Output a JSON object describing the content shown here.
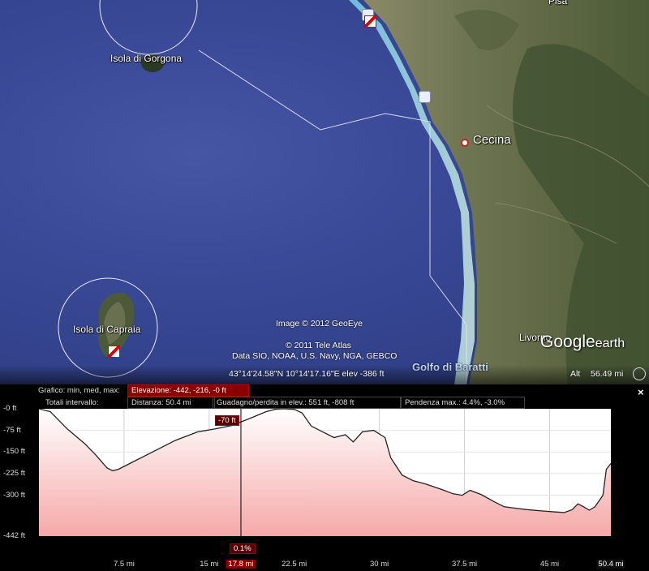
{
  "map": {
    "labels": {
      "gorgona": "Isola di Gorgona",
      "capraia": "Isola di Capraia",
      "cecina": "Cecina",
      "livorno": "Livorno",
      "pisa": "Pisa",
      "golfo": "Golfo di Baratti"
    },
    "credits": {
      "image": "Image © 2012 GeoEye",
      "tele_atlas": "© 2011 Tele Atlas",
      "data": "Data SIO, NOAA, U.S. Navy, NGA, GEBCO"
    },
    "status": {
      "coords": "43°14'24.58\"N  10°14'17.16\"E  elev  -386 ft",
      "alt_label": "Alt",
      "alt_value": "56.49 mi"
    },
    "logo": {
      "google": "Google",
      "earth": "earth"
    }
  },
  "elevation_panel": {
    "row1_label": "Grafico: min, med, max:",
    "elevation_stat": "Elevazione: -442, -216, -0 ft",
    "row2_label": "Totali intervallo:",
    "distance_stat": "Distanza: 50.4 mi",
    "gain_stat": "Guadagno/perdita in elev.: 551 ft, -808 ft",
    "slope_stat": "Pendenza max.: 4.4%, -3.0%",
    "close_label": "×",
    "cursor_value": "-70 ft",
    "cursor_percent": "0.1%",
    "colors": {
      "accent": "#8a0000",
      "fill_top": "#ffffff",
      "fill_bottom": "#f6a8a8",
      "line": "#222222"
    }
  },
  "chart_data": {
    "type": "area",
    "title": "",
    "xlabel": "",
    "ylabel": "",
    "x_ticks": [
      "7.5 mi",
      "15 mi",
      "17.8 mi",
      "22.5 mi",
      "30 mi",
      "37.5 mi",
      "45 mi",
      "50.4 mi"
    ],
    "y_ticks": [
      "-0 ft",
      "-75 ft",
      "-150 ft",
      "-225 ft",
      "-300 ft",
      "-442 ft"
    ],
    "xlim": [
      0,
      50.4
    ],
    "ylim": [
      -442,
      0
    ],
    "grid": true,
    "cursor_x": 17.8,
    "series": [
      {
        "x": [
          0,
          1,
          2.5,
          4,
          5,
          6,
          6.5,
          7,
          8,
          10,
          12,
          14,
          15.5,
          17,
          18.5,
          20,
          20.8,
          21.5,
          22.5,
          23.2,
          24,
          25,
          26,
          27,
          27.7,
          28.5,
          29.5,
          30.5,
          31,
          32,
          33,
          34,
          35.5,
          36.5,
          37.3,
          38,
          39,
          40,
          41,
          43,
          44.5,
          45.5,
          46.3,
          47,
          47.5,
          48,
          48.5,
          49,
          49.7,
          50,
          50.4
        ],
        "values": [
          0,
          -10,
          -70,
          -120,
          -160,
          -205,
          -215,
          -210,
          -190,
          -150,
          -110,
          -80,
          -70,
          -58,
          -35,
          -10,
          -2,
          0,
          -2,
          -15,
          -60,
          -80,
          -100,
          -90,
          -115,
          -80,
          -75,
          -100,
          -170,
          -230,
          -250,
          -260,
          -280,
          -295,
          -300,
          -283,
          -298,
          -320,
          -340,
          -350,
          -355,
          -358,
          -360,
          -350,
          -330,
          -340,
          -352,
          -340,
          -300,
          -210,
          -190
        ]
      }
    ]
  }
}
